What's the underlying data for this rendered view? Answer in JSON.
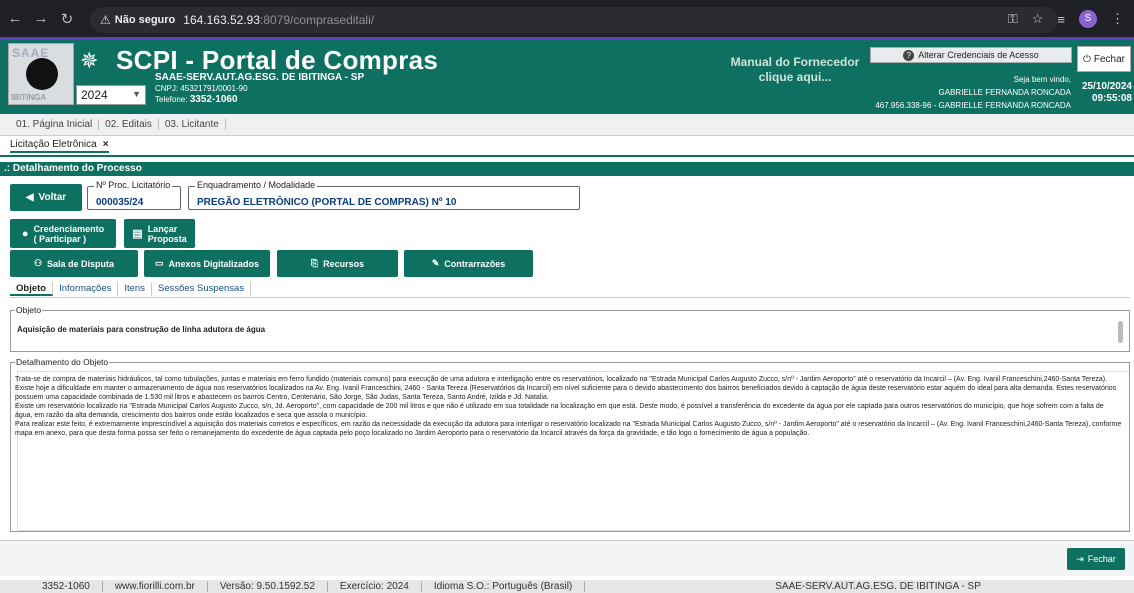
{
  "browser": {
    "insecure_label": "Não seguro",
    "url_host": "164.163.52.93",
    "url_rest": ":8079/compraseditali/",
    "profile_initial": "S"
  },
  "header": {
    "logo_text_top": "SAAE",
    "logo_text_bottom": "IBITINGA",
    "year": "2024",
    "title": "SCPI - Portal de Compras",
    "org": "SAAE-SERV.AUT.AG.ESG. DE IBITINGA - SP",
    "cnpj": "CNPJ: 45321791/0001-90",
    "phone_label": "Telefone:",
    "phone": "3352-1060",
    "manual_line1": "Manual do Fornecedor",
    "manual_line2": "clique aqui...",
    "credentials_label": "Alterar Credenciais de Acesso",
    "welcome": "Seja bem vindo,",
    "user_name": "GABRIELLE FERNANDA RONCADA",
    "user_doc": "467.956.338-96 - GABRIELLE FERNANDA RONCADA",
    "close_label": "Fechar",
    "date": "25/10/2024",
    "time": "09:55:08"
  },
  "menu": {
    "items": [
      "01. Página Inicial",
      "02. Editais",
      "03. Licitante"
    ]
  },
  "doc_tab": {
    "label": "Licitação Eletrônica",
    "close": "×"
  },
  "section_title": ".: Detalhamento do Processo",
  "process": {
    "back_label": "Voltar",
    "proc_legend": "Nº Proc. Licitatório",
    "proc_number": "000035/24",
    "mod_legend": "Enquadramento / Modalidade",
    "modality": "PREGÃO ELETRÔNICO (PORTAL DE COMPRAS) Nº 10"
  },
  "actions": {
    "credenciamento_1": "Credenciamento",
    "credenciamento_2": "( Participar )",
    "lancar_1": "Lançar",
    "lancar_2": "Proposta",
    "sala": "Sala de Disputa",
    "anexos": "Anexos Digitalizados",
    "recursos": "Recursos",
    "contrarrazoes": "Contrarrazões"
  },
  "subtabs": [
    "Objeto",
    "Informações",
    "Itens",
    "Sessões Suspensas"
  ],
  "objeto": {
    "legend": "Objeto",
    "text": "Aquisição de materiais para construção de linha adutora de água"
  },
  "detalhamento": {
    "legend": "Detalhamento do Objeto",
    "paragraphs": [
      "Trata-se de compra de materiais hidráulicos, tal como tubulações, juntas e materiais em ferro fundido (materiais comuns) para execução de uma adutora e interligação entre os reservatórios, localizado na \"Estrada Municipal Carlos Augusto Zucco, s/nº - Jardim Aeroporto\" até o reservatório da Incarcil – (Av. Eng. Ivanil Franceschini,2460-Santa Tereza).",
      "Existe hoje a dificuldade em manter o armazenamento de água nos reservatórios localizados na Av. Eng. Ivanil Franceschini, 2460 - Santa Tereza (Reservatórios da Incarcil) em nível suficiente para o devido abastecimento dos bairros beneficiados devido à captação de água deste reservatório estar aquém do ideal para alta demanda. Estes reservatórios possuem uma capacidade combinada de 1.530 mil litros e abastecem os bairros Centro, Centenário, São Jorge, São Judas, Santa Tereza, Santo André, Izilda e Jd. Natalia.",
      "Existe um reservatório localizado na \"Estrada Municipal Carlos Augusto Zucco, s/n, Jd. Aeroporto\", com capacidade de 200 mil litros e que não é utilizado em sua totalidade na localização em que está. Deste modo, é possível a transferência do excedente da água por ele captada para outros reservatórios do município, que hoje sofrem com a falta de água, em razão da alta demanda, crescimento dos bairros onde estão localizados e seca que assola o município.",
      "Para realizar este feito, é extremamente imprescindível a aquisição dos materiais corretos e específicos, em razão da necessidade da execução da adutora para interligar o reservatório localizado na \"Estrada Municipal Carlos Augusto Zucco, s/nº - Jardim Aeroporto\" até o reservatório da Incarcil – (Av. Eng. Ivanil Franceschini,2460-Santa Tereza), conforme mapa em anexo, para que desta forma possa ser feito o remanejamento do excedente de água captada pelo poço localizado no Jardim Aeroporto para o reservatório da Incarcil através da força da gravidade, e tão logo o fornecimento de água a população."
    ]
  },
  "footer": {
    "close_label": "Fechar",
    "status": [
      "3352-1060",
      "www.fiorilli.com.br",
      "Versão: 9.50.1592.52",
      "Exercício: 2024",
      "Idioma S.O.: Português (Brasil)"
    ],
    "org": "SAAE-SERV.AUT.AG.ESG. DE IBITINGA - SP"
  }
}
